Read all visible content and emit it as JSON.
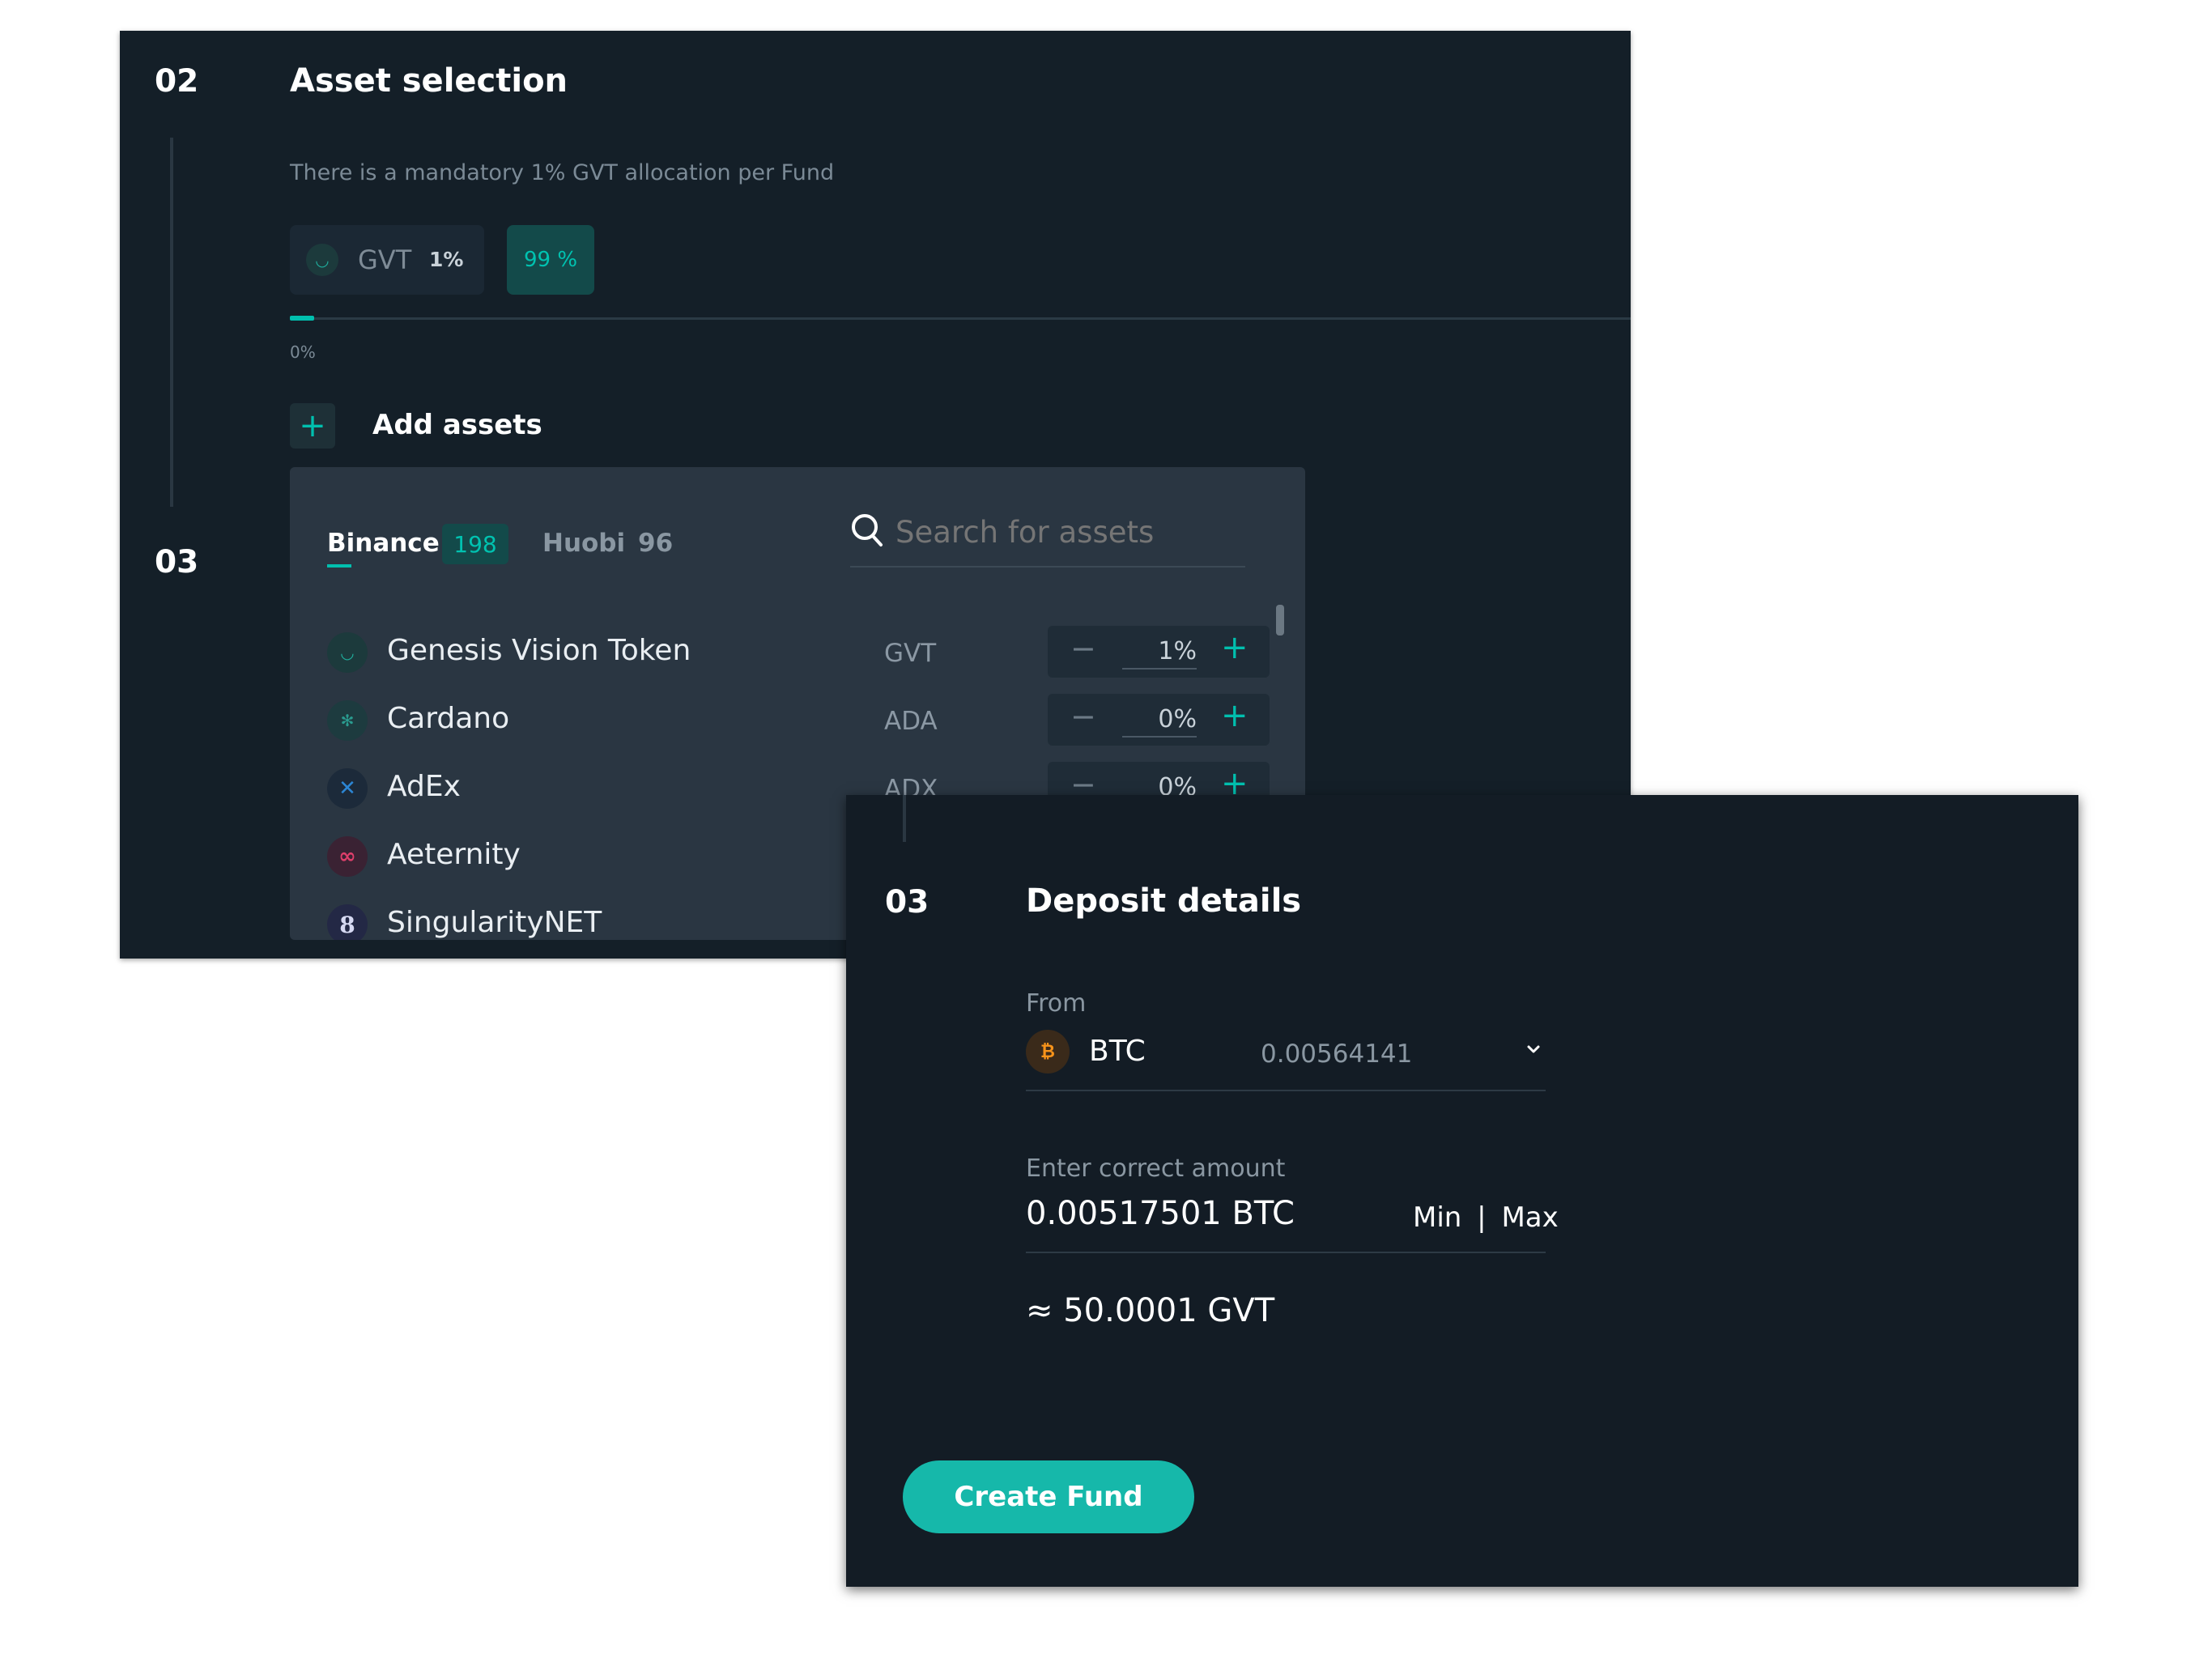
{
  "asset_selection": {
    "step_number": "02",
    "title": "Asset selection",
    "note": "There is a mandatory 1% GVT allocation per Fund",
    "gvt_chip": {
      "symbol": "GVT",
      "percent": "1%"
    },
    "remaining_chip": "99 %",
    "progress_label": "0%",
    "progress_value": 0.01,
    "add_assets_icon": "+",
    "add_assets_label": "Add assets",
    "next_step_number": "03"
  },
  "asset_dropdown": {
    "tabs": [
      {
        "label": "Binance",
        "count": "198",
        "active": true
      },
      {
        "label": "Huobi",
        "count": "96",
        "active": false
      }
    ],
    "search": {
      "placeholder": "Search for assets",
      "icon": "search-icon"
    },
    "assets": [
      {
        "name": "Genesis Vision Token",
        "code": "GVT",
        "percent": "1%",
        "icon": "gvt-icon",
        "color": "#1fae9c"
      },
      {
        "name": "Cardano",
        "code": "ADA",
        "percent": "0%",
        "icon": "cardano-icon",
        "color": "#2a9b8f"
      },
      {
        "name": "AdEx",
        "code": "ADX",
        "percent": "0%",
        "icon": "adex-icon",
        "color": "#1b75bc"
      },
      {
        "name": "Aeternity",
        "code": "",
        "percent": "",
        "icon": "aeternity-icon",
        "color": "#de3f6b"
      },
      {
        "name": "SingularityNET",
        "code": "",
        "percent": "",
        "icon": "singularitynet-icon",
        "color": "#6f5bd9"
      }
    ],
    "minus_symbol": "−",
    "plus_symbol": "+"
  },
  "deposit_details": {
    "step_number": "03",
    "title": "Deposit details",
    "from_label": "From",
    "currency": "BTC",
    "currency_icon_glyph": "₿",
    "balance": "0.00564141",
    "amount_label": "Enter correct amount",
    "amount_value": "0.00517501 BTC",
    "min_label": "Min",
    "divider": "|",
    "max_label": "Max",
    "converted_value": "≈ 50.0001 GVT",
    "create_button": "Create Fund"
  },
  "colors": {
    "panel_bg": "#141f28",
    "dropdown_bg": "#2a3642",
    "accent_teal": "#16b8aa",
    "btc_orange": "#f7931a"
  }
}
